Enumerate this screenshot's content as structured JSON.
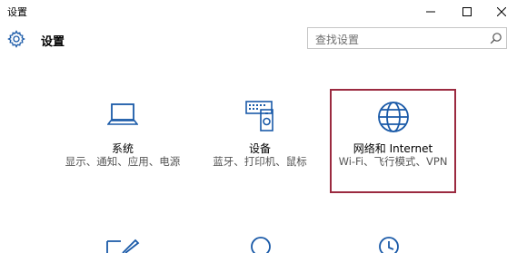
{
  "window": {
    "title": "设置",
    "controls": {
      "minimize": "—",
      "maximize": "□",
      "close": "✕"
    }
  },
  "header": {
    "title": "设置",
    "search_placeholder": "查找设置"
  },
  "tiles": [
    {
      "name": "系统",
      "desc": "显示、通知、应用、电源",
      "icon": "laptop-icon"
    },
    {
      "name": "设备",
      "desc": "蓝牙、打印机、鼠标",
      "icon": "devices-icon"
    },
    {
      "name": "网络和 Internet",
      "desc": "Wi-Fi、飞行模式、VPN",
      "icon": "globe-icon",
      "highlighted": true
    }
  ],
  "partial_tiles": [
    "personalization-icon",
    "accounts-icon",
    "time-language-icon"
  ],
  "colors": {
    "accent": "#1a5aa8",
    "highlight_border": "#9b2a40"
  }
}
